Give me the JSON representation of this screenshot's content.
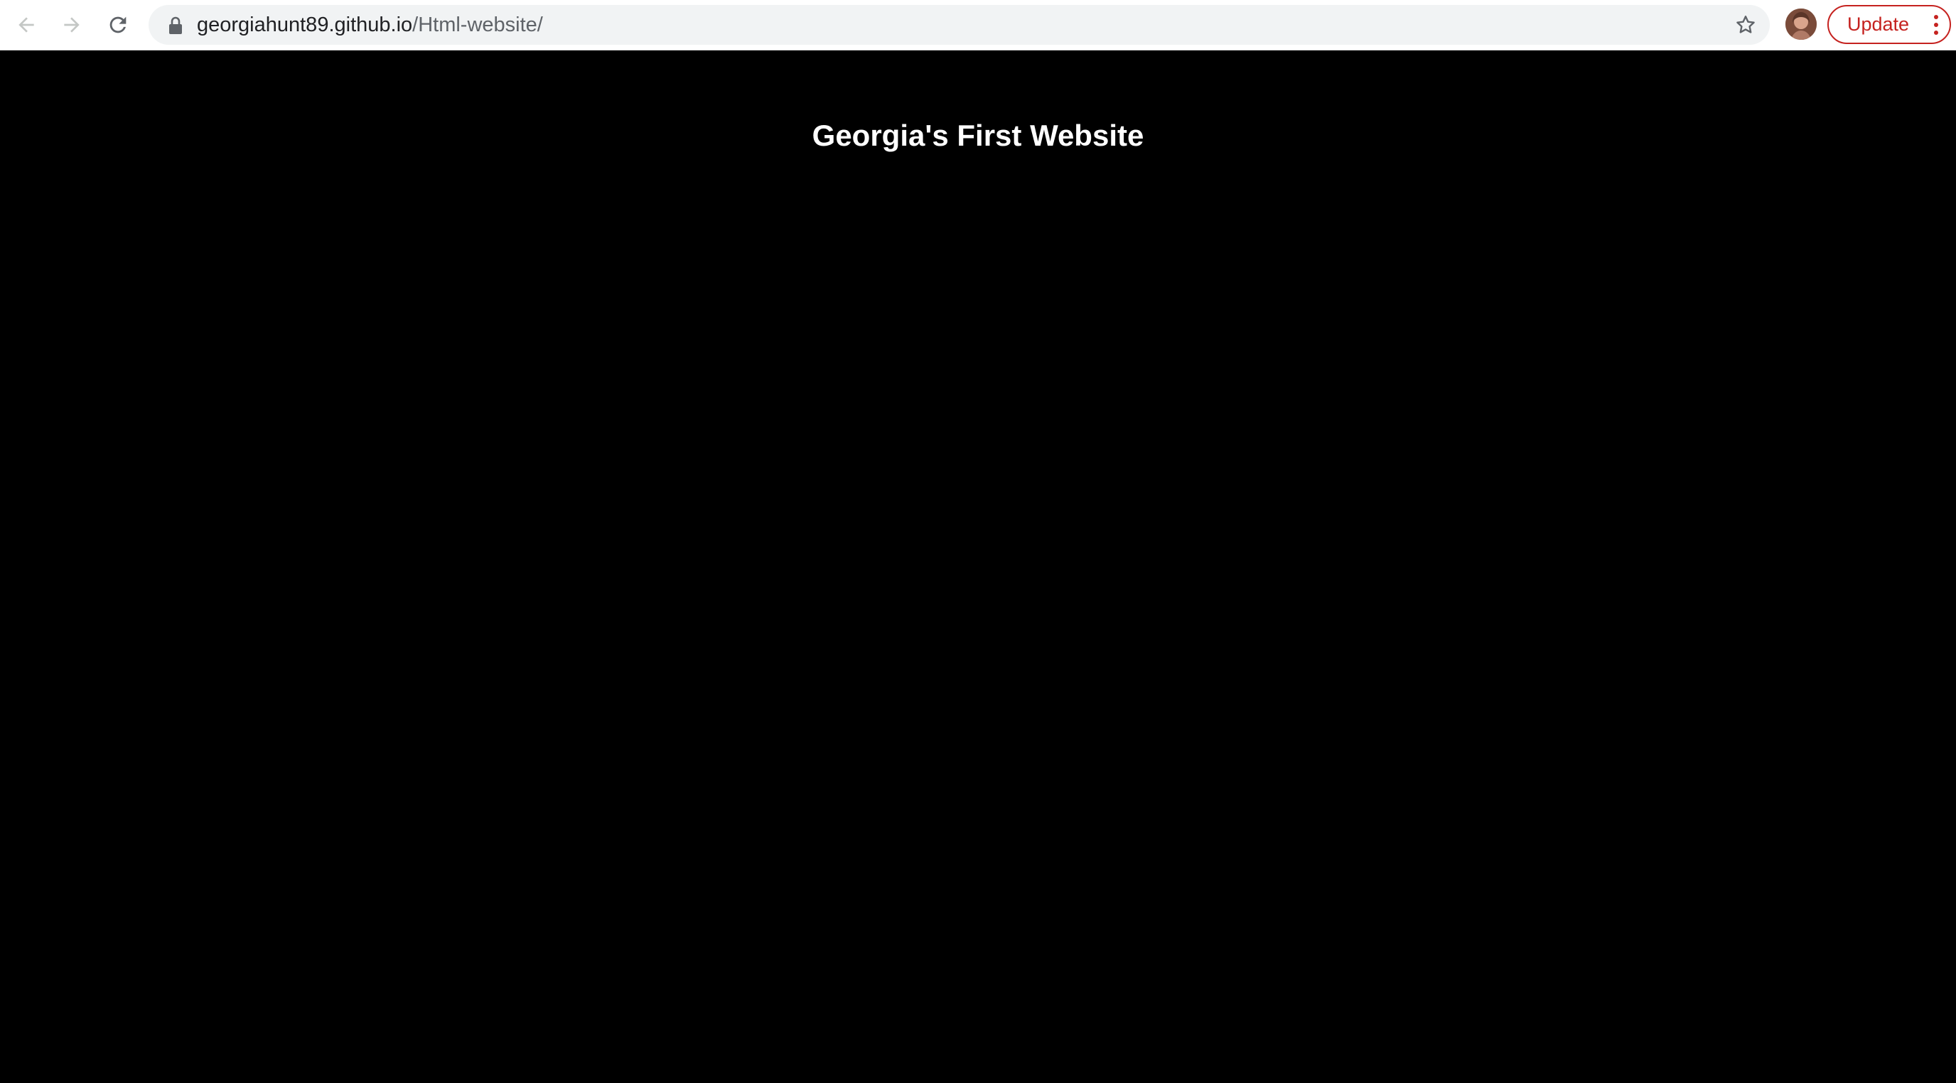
{
  "browser": {
    "url": {
      "host": "georgiahunt89.github.io",
      "path": "/Html-website/"
    },
    "update_label": "Update",
    "icons": {
      "back": "arrow-left-icon",
      "forward": "arrow-right-icon",
      "reload": "reload-icon",
      "lock": "lock-icon",
      "bookmark": "star-icon",
      "menu": "kebab-menu-icon"
    },
    "colors": {
      "toolbar_bg": "#ffffff",
      "omnibox_bg": "#f1f3f4",
      "update_accent": "#c5221f"
    }
  },
  "page": {
    "title": "Georgia's First Website",
    "background": "#000000",
    "text_color": "#ffffff"
  }
}
